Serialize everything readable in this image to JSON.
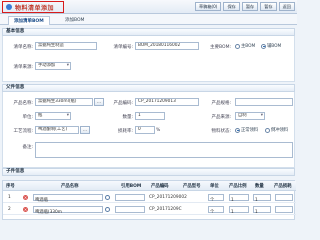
{
  "window": {
    "title": "物料清单添加"
  },
  "toolbar": {
    "buttons": [
      "草稿箱(0)",
      "保存",
      "暂存",
      "暂存",
      "返回"
    ]
  },
  "tabs": [
    {
      "label": "添加清单BOM",
      "active": true
    },
    {
      "label": "添加BOM",
      "active": false
    }
  ],
  "sections": {
    "basic": "基本信息",
    "product": "父件信息",
    "children": "子件信息"
  },
  "basic": {
    "list_no_label": "清单编号:",
    "list_no_value": "",
    "list_name_label": "清单名称:",
    "list_name_value": "票据纯生制造",
    "ext_no_label": "清单编号:",
    "ext_no_value": "BOM_20180116002",
    "main_bom_label": "主要BOM:",
    "main_bom_yes": "主BOM",
    "main_bom_no": "辅BOM",
    "category_label": "清单来源:",
    "category_value": "手动添加"
  },
  "product": {
    "name_label": "产品名称:",
    "name_value": "票据纯生330ml(瓶)",
    "code_label": "产品编码:",
    "code_value": "CP_20171209013",
    "spec_label": "产品规格:",
    "spec_value": "",
    "unit_label": "单位:",
    "unit_value": "瓶",
    "qty_label": "数量:",
    "qty_value": "1",
    "loss_label": "产品来源:",
    "loss_value": "自制",
    "process_label": "工艺流程:",
    "process_value": "啤酒酿制(工艺)",
    "loss_rate_label": "损耗率:",
    "loss_rate_value": "0",
    "pct": "%",
    "state_label": "物料状态:",
    "state_normal": "正常领料",
    "state_return": "倒冲领料",
    "remark_label": "备注:",
    "remark_value": ""
  },
  "grid": {
    "headers": [
      "序号",
      "",
      "产品名称",
      "引用BOM",
      "产品编码",
      "产品型号",
      "单位",
      "产品比例",
      "数量",
      "产品损耗"
    ],
    "rows": [
      {
        "no": "1",
        "name": "啤酒瓶",
        "code": "CP_20171209002",
        "unit": "个",
        "ratio": "1",
        "qty": "1"
      },
      {
        "no": "2",
        "name": "啤酒瓶(330m",
        "code": "CP_20171209C",
        "unit": "个",
        "ratio": "1",
        "qty": "1"
      }
    ]
  }
}
